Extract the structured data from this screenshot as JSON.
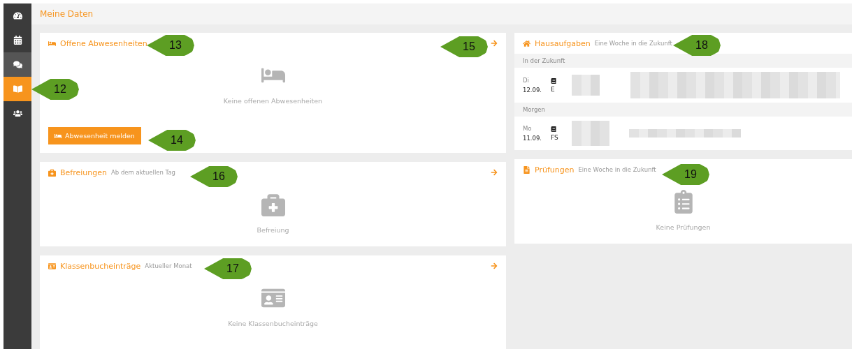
{
  "sidebar": {
    "items": [
      {
        "kind": "dashboard",
        "selected": false,
        "hovered": false
      },
      {
        "kind": "calendar",
        "selected": false,
        "hovered": false
      },
      {
        "kind": "messages",
        "selected": false,
        "hovered": true
      },
      {
        "kind": "book",
        "selected": true,
        "hovered": false
      },
      {
        "kind": "users",
        "selected": false,
        "hovered": false
      }
    ]
  },
  "page_title": "Meine Daten",
  "left_cards": [
    {
      "kind": "empty",
      "title": "Offene Abwesenheiten",
      "arrow": true,
      "message": "Keine offenen Abwesenheiten",
      "button": {
        "label": "Abwesenheit melden"
      }
    },
    {
      "kind": "empty",
      "title": "Befreiungen",
      "subtitle": "Ab dem aktuellen Tag",
      "arrow": true,
      "message": "Befreiung"
    },
    {
      "kind": "empty",
      "title": "Klassenbucheinträge",
      "subtitle": "Aktueller Monat",
      "arrow": true,
      "message": "Keine Klassenbucheinträge"
    }
  ],
  "right_cards": [
    {
      "kind": "homework",
      "title": "Hausaufgaben",
      "subtitle": "Eine Woche in die Zukunft",
      "arrow": false,
      "groups": [
        {
          "label": "In der Zukunft",
          "entries": [
            {
              "day": "Di",
              "date": "12.09.",
              "subject": "E"
            }
          ]
        },
        {
          "label": "Morgen",
          "entries": [
            {
              "day": "Mo",
              "date": "11.09.",
              "subject": "FS"
            }
          ]
        }
      ]
    },
    {
      "kind": "empty",
      "title": "Prüfungen",
      "subtitle": "Eine Woche in die Zukunft",
      "arrow": false,
      "message": "Keine Prüfungen"
    }
  ],
  "callouts": [
    "12",
    "13",
    "14",
    "15",
    "16",
    "17",
    "18",
    "19"
  ]
}
